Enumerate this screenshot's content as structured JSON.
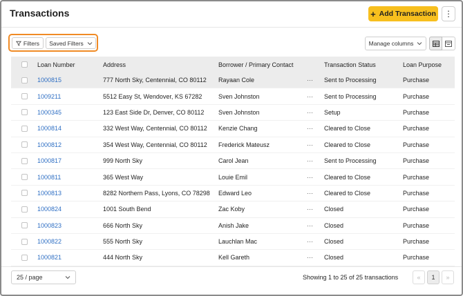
{
  "header": {
    "title": "Transactions",
    "add_button_label": "Add Transaction",
    "more_button_label": "⋮"
  },
  "toolbar": {
    "filters_label": "Filters",
    "saved_filters_label": "Saved Filters",
    "manage_columns_label": "Manage columns"
  },
  "table": {
    "columns": [
      "Loan Number",
      "Address",
      "Borrower / Primary Contact",
      "Transaction Status",
      "Loan Purpose"
    ],
    "row_action_glyph": "···",
    "rows": [
      {
        "loan": "1000815",
        "address": "777 North Sky, Centennial, CO 80112",
        "borrower": "Rayaan Cole",
        "status": "Sent to Processing",
        "purpose": "Purchase",
        "highlighted": true
      },
      {
        "loan": "1009211",
        "address": "5512 Easy St, Wendover, KS 67282",
        "borrower": "Sven Johnston",
        "status": "Sent to Processing",
        "purpose": "Purchase"
      },
      {
        "loan": "1000345",
        "address": "123 East Side Dr, Denver, CO 80112",
        "borrower": "Sven Johnston",
        "status": "Setup",
        "purpose": "Purchase"
      },
      {
        "loan": "1000814",
        "address": "332 West Way, Centennial, CO 80112",
        "borrower": "Kenzie Chang",
        "status": "Cleared to Close",
        "purpose": "Purchase"
      },
      {
        "loan": "1000812",
        "address": "354 West Way, Centennial, CO 80112",
        "borrower": "Frederick Mateusz",
        "status": "Cleared to Close",
        "purpose": "Purchase"
      },
      {
        "loan": "1000817",
        "address": "999 North Sky",
        "borrower": "Carol Jean",
        "status": "Sent to Processing",
        "purpose": "Purchase"
      },
      {
        "loan": "1000811",
        "address": "365 West Way",
        "borrower": "Louie Emil",
        "status": "Cleared to Close",
        "purpose": "Purchase"
      },
      {
        "loan": "1000813",
        "address": "8282 Northern Pass, Lyons, CO 78298",
        "borrower": "Edward Leo",
        "status": "Cleared to Close",
        "purpose": "Purchase"
      },
      {
        "loan": "1000824",
        "address": "1001 South Bend",
        "borrower": "Zac Koby",
        "status": "Closed",
        "purpose": "Purchase"
      },
      {
        "loan": "1000823",
        "address": "666 North Sky",
        "borrower": "Anish Jake",
        "status": "Closed",
        "purpose": "Purchase"
      },
      {
        "loan": "1000822",
        "address": "555 North Sky",
        "borrower": "Lauchlan Mac",
        "status": "Closed",
        "purpose": "Purchase"
      },
      {
        "loan": "1000821",
        "address": "444 North Sky",
        "borrower": "Kell Gareth",
        "status": "Closed",
        "purpose": "Purchase"
      }
    ]
  },
  "footer": {
    "per_page": "25 / page",
    "showing": "Showing 1 to 25 of 25 transactions",
    "prev_label": "«",
    "current_page": "1",
    "next_label": "»"
  },
  "colors": {
    "accent": "#f7bf1e",
    "filter_highlight": "#f08a24",
    "link": "#2f6fc4"
  },
  "icons": [
    "filter-icon",
    "chevron-down-icon",
    "kebab-icon",
    "table-view-icon",
    "card-view-icon",
    "plus-icon"
  ]
}
